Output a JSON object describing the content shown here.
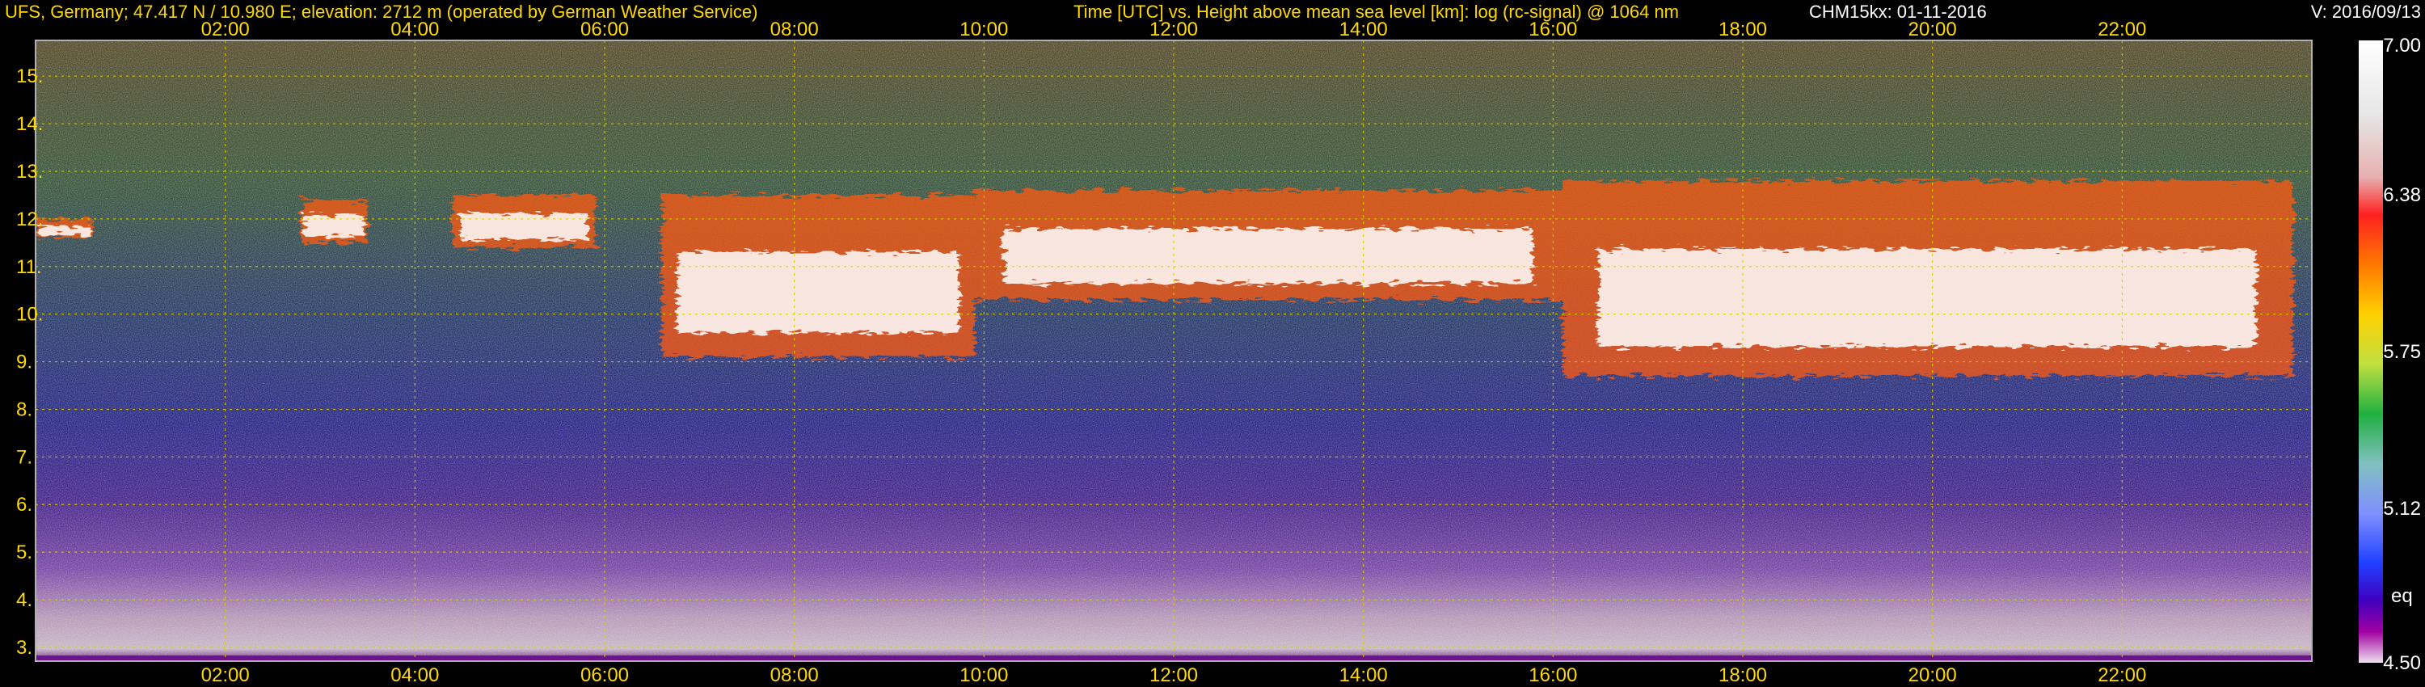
{
  "header": {
    "station": "UFS, Germany; 47.417 N / 10.980 E; elevation: 2712 m  (operated by German Weather Service)",
    "axes_desc": "Time [UTC] vs. Height above mean sea level [km]: log (rc-signal) @ 1064 nm",
    "instrument": "CHM15kx: 01-11-2016",
    "version": "V: 2016/09/13"
  },
  "colors": {
    "header_text": "#ffd800",
    "white_text": "#ffffff",
    "grid": "#d8d000",
    "frame": "#b0b0b0",
    "background": "#000000"
  },
  "chart_data": {
    "type": "heatmap",
    "x_unit": "UTC",
    "x_tick_labels": [
      "02:00",
      "04:00",
      "06:00",
      "08:00",
      "10:00",
      "12:00",
      "14:00",
      "16:00",
      "18:00",
      "20:00",
      "22:00"
    ],
    "x_ticks_hours": [
      2,
      4,
      6,
      8,
      10,
      12,
      14,
      16,
      18,
      20,
      22
    ],
    "xlim_hours": [
      0,
      24
    ],
    "y_tick_labels": [
      "3.",
      "4.",
      "5.",
      "6.",
      "7.",
      "8.",
      "9.",
      "10.",
      "11.",
      "12.",
      "13.",
      "14.",
      "15."
    ],
    "y_ticks_km": [
      3,
      4,
      5,
      6,
      7,
      8,
      9,
      10,
      11,
      12,
      13,
      14,
      15
    ],
    "ylim_km": [
      2.71,
      15.75
    ],
    "grid": true,
    "colorbar": {
      "labels": [
        "7.00",
        "6.38",
        "5.75",
        "5.12",
        "4.50"
      ],
      "values": [
        7.0,
        6.38,
        5.75,
        5.12,
        4.5
      ],
      "range": [
        4.5,
        7.0
      ],
      "small_label": "eq"
    },
    "cloud_layers": [
      {
        "start_h": 0.0,
        "end_h": 0.6,
        "base_km": 11.6,
        "top_km": 12.0
      },
      {
        "start_h": 2.8,
        "end_h": 3.5,
        "base_km": 11.5,
        "top_km": 12.4
      },
      {
        "start_h": 4.4,
        "end_h": 5.9,
        "base_km": 11.4,
        "top_km": 12.5
      },
      {
        "start_h": 6.6,
        "end_h": 9.9,
        "base_km": 9.1,
        "top_km": 12.5
      },
      {
        "start_h": 9.9,
        "end_h": 16.1,
        "base_km": 10.3,
        "top_km": 12.6
      },
      {
        "start_h": 16.1,
        "end_h": 23.8,
        "base_km": 8.7,
        "top_km": 12.8
      }
    ]
  }
}
